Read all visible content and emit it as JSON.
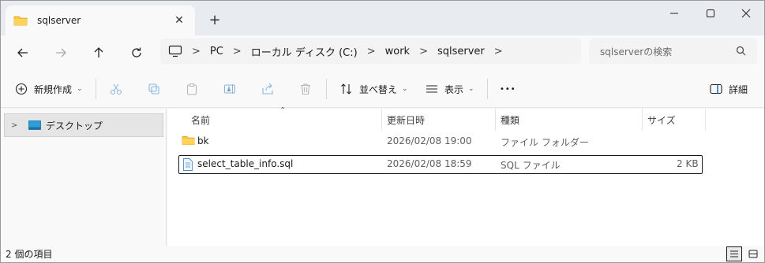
{
  "window": {
    "tab_title": "sqlserver",
    "new_tab_symbol": "+",
    "tab_close_symbol": "✕"
  },
  "address": {
    "breadcrumbs": [
      "PC",
      "ローカル ディスク (C:)",
      "work",
      "sqlserver"
    ],
    "search_placeholder": "sqlserverの検索"
  },
  "toolbar": {
    "new_label": "新規作成",
    "sort_label": "並べ替え",
    "view_label": "表示",
    "more_label": "•••",
    "details_label": "詳細"
  },
  "sidebar": {
    "items": [
      {
        "label": "デスクトップ"
      }
    ]
  },
  "columns": {
    "name": "名前",
    "date": "更新日時",
    "type": "種類",
    "size": "サイズ"
  },
  "files": [
    {
      "name": "bk",
      "date": "2026/02/08 19:00",
      "type": "ファイル フォルダー",
      "size": ""
    },
    {
      "name": "select_table_info.sql",
      "date": "2026/02/08 18:59",
      "type": "SQL ファイル",
      "size": "2 KB"
    }
  ],
  "status": {
    "item_count": "2 個の項目"
  },
  "colors": {
    "folder": "#f6c644",
    "accent": "#0067c0"
  }
}
